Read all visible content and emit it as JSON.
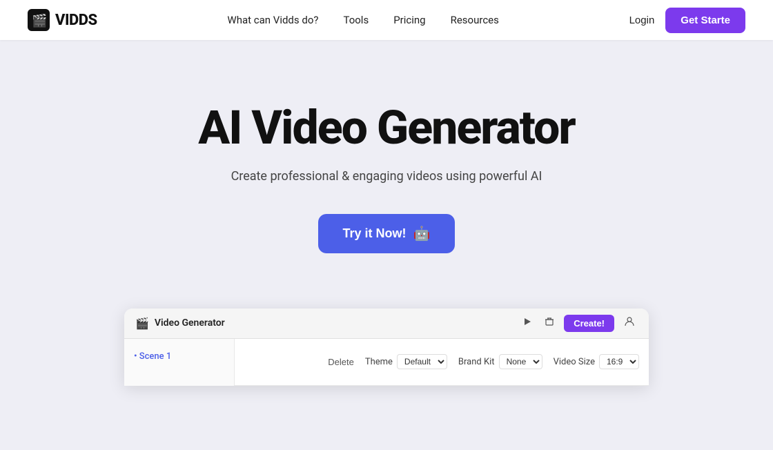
{
  "navbar": {
    "logo_text": "VIDDS",
    "nav_links": [
      {
        "label": "What can Vidds do?",
        "id": "what-can-vidds"
      },
      {
        "label": "Tools",
        "id": "tools"
      },
      {
        "label": "Pricing",
        "id": "pricing"
      },
      {
        "label": "Resources",
        "id": "resources"
      }
    ],
    "login_label": "Login",
    "get_started_label": "Get Starte"
  },
  "hero": {
    "title": "AI Video Generator",
    "subtitle": "Create professional & engaging videos using powerful AI",
    "cta_button": "Try it Now!",
    "robot_icon": "🤖"
  },
  "preview": {
    "window_title": "Video Generator",
    "create_button": "Create!",
    "scene_label": "• Scene 1",
    "delete_label": "Delete",
    "theme_label": "Theme",
    "brand_kit_label": "Brand Kit",
    "video_size_label": "Video Size"
  },
  "colors": {
    "accent_purple": "#7c3aed",
    "accent_blue": "#4c5fe8",
    "bg_light": "#eeeef5",
    "white": "#ffffff"
  }
}
